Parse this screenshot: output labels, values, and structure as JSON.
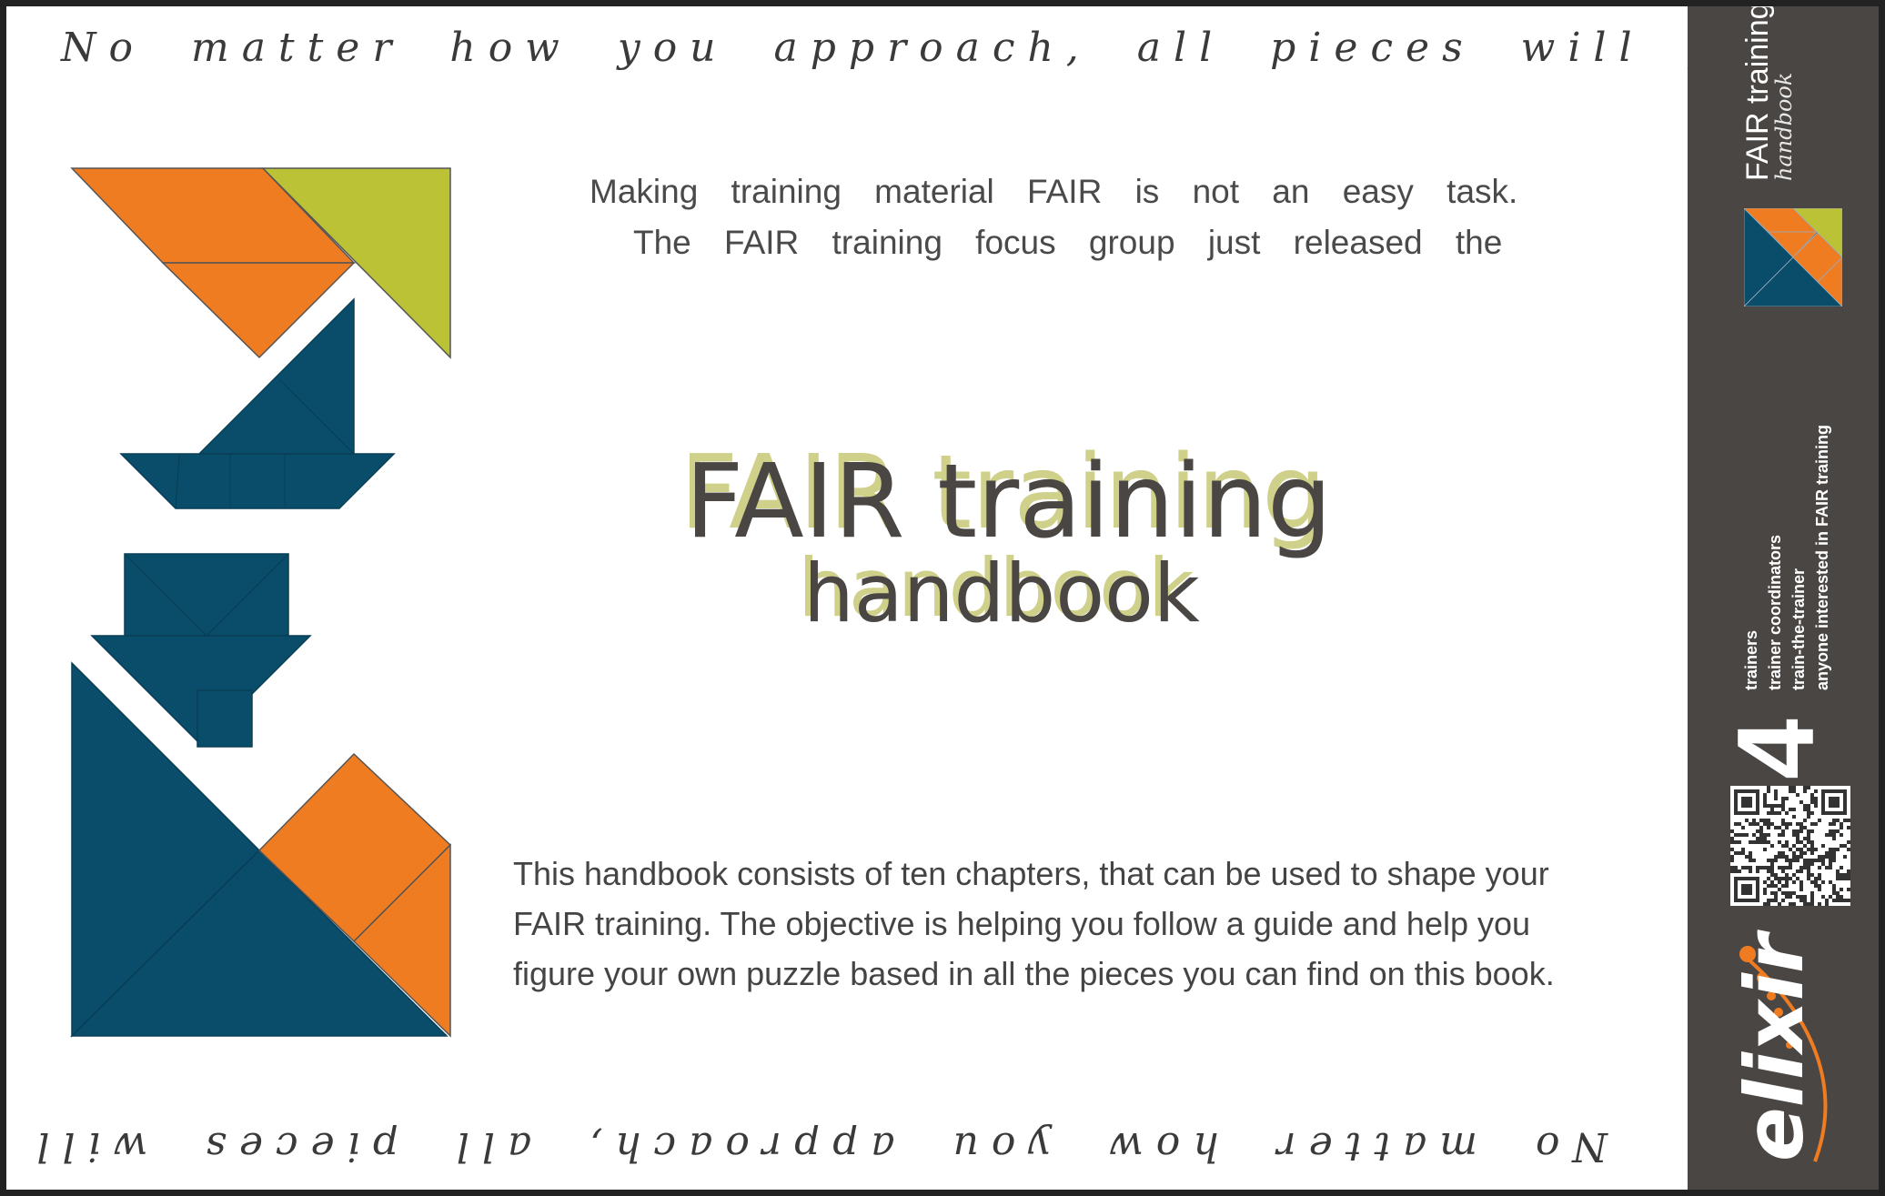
{
  "motto": "No matter how you approach, all pieces will fit together",
  "intro": [
    "Making training material FAIR is not an easy task.",
    "The FAIR training focus group just released the"
  ],
  "title": {
    "line1": "FAIR training",
    "line2": "handbook"
  },
  "description": "This handbook consists of ten chapters, that can be used to shape your FAIR training. The objective is helping you follow a guide and help you figure your own puzzle based in all the pieces you can find on this book.",
  "sidebar": {
    "title": "FAIR training",
    "subtitle": "handbook",
    "number": "4",
    "audience": [
      "trainers",
      "trainer coordinators",
      "train-the-trainer",
      "anyone interested in FAIR training"
    ],
    "logo_text": "elixir"
  },
  "colors": {
    "orange": "#f07c22",
    "olive": "#bcc235",
    "teal": "#0a4d6a",
    "sidebar": "#4a4644",
    "text": "#4a4644",
    "title_shadow": "#cfd08a"
  }
}
